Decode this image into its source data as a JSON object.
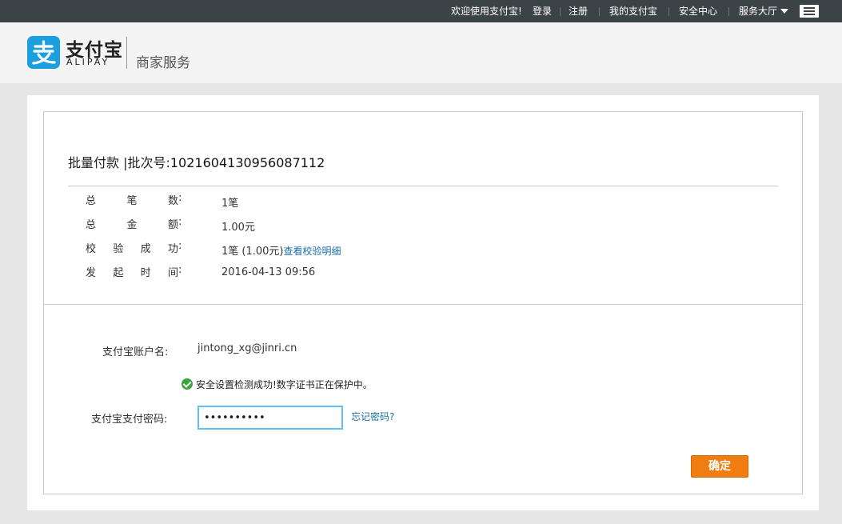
{
  "topbar": {
    "welcome": "欢迎使用支付宝!",
    "login": "登录",
    "register": "注册",
    "my_alipay": "我的支付宝",
    "security_center": "安全中心",
    "service_hall": "服务大厅"
  },
  "header": {
    "logo_cn": "支付宝",
    "logo_en": "ALIPAY",
    "service": "商家服务"
  },
  "batch": {
    "title_prefix": "批量付款 |批次号:",
    "batch_no": "1021604130956087112",
    "rows": [
      {
        "label_chars": [
          "总",
          "笔",
          "数"
        ],
        "value": "1笔"
      },
      {
        "label_chars": [
          "总",
          "金",
          "额"
        ],
        "value": "1.00元"
      },
      {
        "label_chars": [
          "校",
          "验",
          "成",
          "功"
        ],
        "value": "1笔 (1.00元)",
        "link": "查看校验明细"
      },
      {
        "label_chars": [
          "发",
          "起",
          "时",
          "间"
        ],
        "value": "2016-04-13 09:56"
      }
    ]
  },
  "form": {
    "account_label": "支付宝账户名:",
    "account_value": "jintong_xg@jinri.cn",
    "security_notice": "安全设置检测成功!数字证书正在保护中。",
    "password_label": "支付宝支付密码:",
    "password_value": "••••••••••",
    "forgot_password": "忘记密码?",
    "confirm": "确定"
  },
  "colors": {
    "topbar_bg": "#3c4347",
    "brand_blue": "#1a9fdf",
    "confirm_orange": "#ef7d12",
    "link_blue": "#1a6ea8",
    "success_green": "#39a53c"
  }
}
